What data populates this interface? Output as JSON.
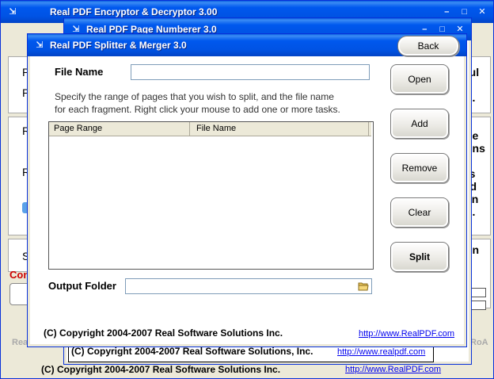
{
  "windows": {
    "encryptor": {
      "title": "Real PDF Encryptor & Decryptor 3.00",
      "copyright": "(C) Copyright 2004-2007 Real Software Solutions Inc.",
      "link": "http://www.RealPDF.com",
      "side_text": [
        "ful",
        "o",
        "d.",
        "de",
        "ons",
        "r.",
        "ts",
        "rd",
        "an",
        "d.",
        "on",
        "e"
      ],
      "fragments": [
        "P",
        "P",
        "R",
        "R",
        "S",
        "Con",
        "Rea",
        "RoA"
      ]
    },
    "numberer": {
      "title": "Real PDF Page Numberer 3.0",
      "copyright": "(C) Copyright 2004-2007 Real Software Solutions, Inc.",
      "link": "http://www.realpdf.com"
    },
    "splitter": {
      "title": "Real PDF Splitter & Merger 3.0",
      "back_label": "Back",
      "file_name_label": "File Name",
      "file_name_value": "",
      "instructions_line1": "Specify the range of pages that you wish to split, and the file name",
      "instructions_line2": "for each fragment. Right click your mouse to add one or more tasks.",
      "table_columns": [
        "Page Range",
        "File Name"
      ],
      "output_folder_label": "Output Folder",
      "output_folder_value": "",
      "buttons": {
        "open": "Open",
        "add": "Add",
        "remove": "Remove",
        "clear": "Clear",
        "split": "Split"
      },
      "copyright": "(C) Copyright 2004-2007 Real Software Solutions Inc.",
      "link": "http://www.RealPDF.com"
    }
  },
  "colors": {
    "titlebar_blue": "#0053e4",
    "window_border": "#0831d9",
    "error_red": "#cc0000"
  }
}
